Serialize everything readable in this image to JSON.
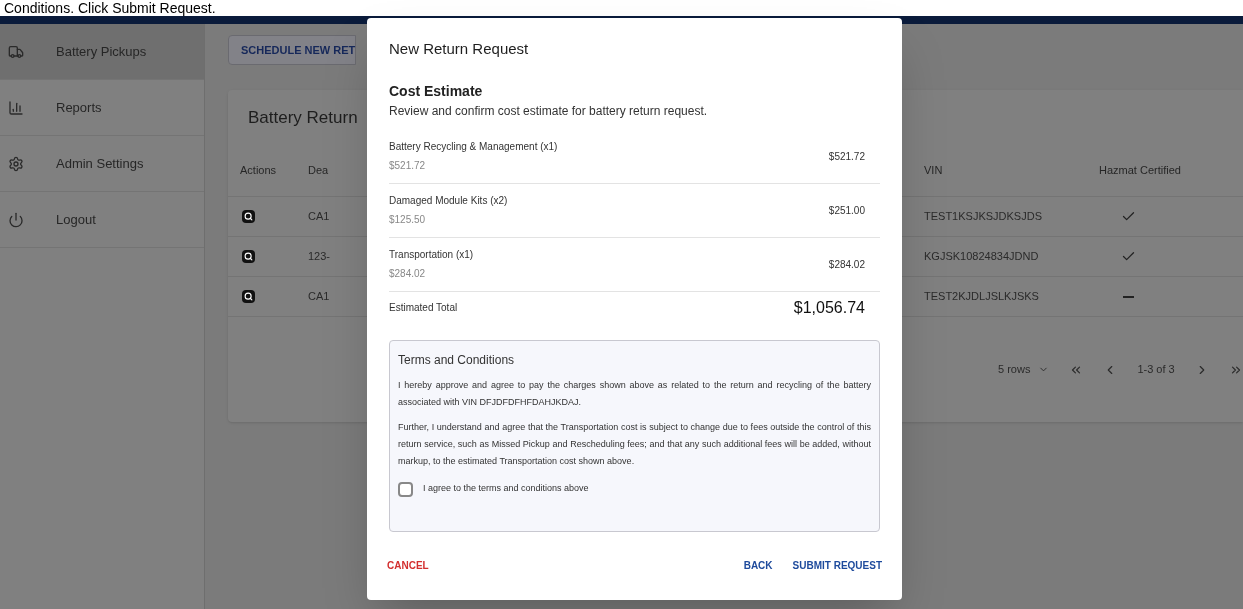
{
  "caption": "Conditions. Click Submit Request.",
  "sidebar": {
    "items": [
      {
        "label": "Battery Pickups",
        "selected": true
      },
      {
        "label": "Reports",
        "selected": false
      },
      {
        "label": "Admin Settings",
        "selected": false
      },
      {
        "label": "Logout",
        "selected": false
      }
    ]
  },
  "schedule_button": "SCHEDULE NEW RET",
  "card": {
    "title": "Battery Return",
    "columns": [
      "Actions",
      "Dea",
      "VIN",
      "Hazmat Certified"
    ],
    "rows": [
      {
        "column_2": "CA1",
        "vin": "TEST1KSJKSJDKSJDS",
        "hazmat": true
      },
      {
        "column_2": "123-",
        "vin": "KGJSK10824834JDND",
        "hazmat": true
      },
      {
        "column_2": "CA1",
        "vin": "TEST2KJDLJSLKJSKS",
        "hazmat": false
      }
    ],
    "pagination": {
      "rows_per_page": "5 rows",
      "range": "1-3 of 3"
    }
  },
  "dialog": {
    "title": "New Return Request",
    "section_title": "Cost Estimate",
    "subtitle": "Review and confirm cost estimate for battery return request.",
    "items": [
      {
        "name": "Battery Recycling & Management (x1)",
        "unit_price": "$521.72",
        "total": "$521.72"
      },
      {
        "name": "Damaged Module Kits (x2)",
        "unit_price": "$125.50",
        "total": "$251.00"
      },
      {
        "name": "Transportation (x1)",
        "unit_price": "$284.02",
        "total": "$284.02"
      }
    ],
    "total_label": "Estimated Total",
    "total": "$1,056.74",
    "terms": {
      "title": "Terms and Conditions",
      "paragraphs": [
        "I hereby approve and agree to pay the charges shown above as related to the return and recycling of the battery associated with VIN DFJDFDFHFDAHJKDAJ.",
        "Further, I understand and agree that the Transportation cost is subject to change due to fees outside the control of this return service, such as Missed Pickup and Rescheduling fees; and that any such additional fees will be added, without markup, to the estimated Transportation cost shown above."
      ],
      "agree_label": "I agree to the terms and conditions above",
      "checked": false
    },
    "cancel": "CANCEL",
    "back": "BACK",
    "submit": "SUBMIT REQUEST"
  }
}
